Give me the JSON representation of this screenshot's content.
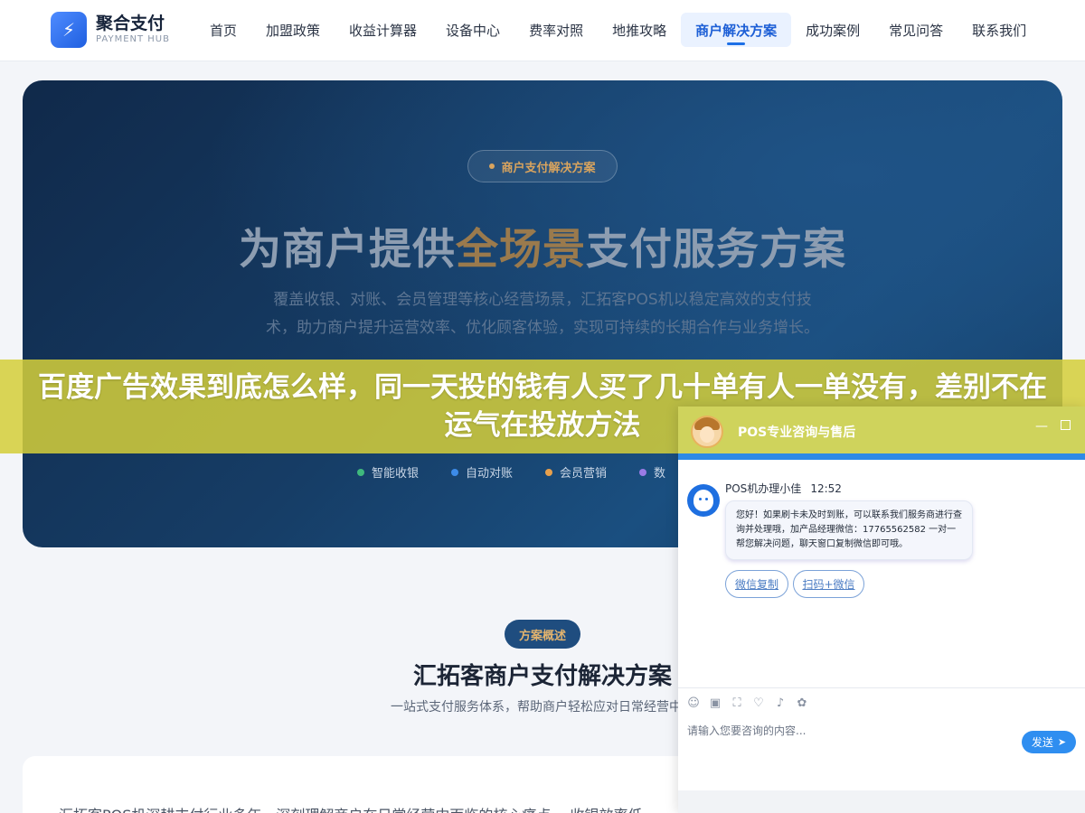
{
  "logo": {
    "name": "聚合支付",
    "sub": "PAYMENT HUB",
    "icon": "lightning-icon"
  },
  "nav": {
    "items": [
      "首页",
      "加盟政策",
      "收益计算器",
      "设备中心",
      "费率对照",
      "地推攻略",
      "商户解决方案",
      "成功案例",
      "常见问答",
      "联系我们"
    ],
    "active_index": 6
  },
  "hero": {
    "badge": "商户支付解决方案",
    "title_pre": "为商户提供",
    "title_highlight": "全场景",
    "title_post": "支付服务方案",
    "desc": "覆盖收银、对账、会员管理等核心经营场景，汇拓客POS机以稳定高效的支付技术，助力商户提升运营效率、优化顾客体验，实现可持续的长期合作与业务增长。",
    "tags": [
      {
        "label": "智能收银",
        "color": "#3fb97d"
      },
      {
        "label": "自动对账",
        "color": "#3d8be8"
      },
      {
        "label": "会员营销",
        "color": "#e8a04c"
      },
      {
        "label": "数",
        "color": "#9b7be6"
      }
    ]
  },
  "section": {
    "badge": "方案概述",
    "title": "汇拓客商户支付解决方案",
    "subtitle": "一站式支付服务体系，帮助商户轻松应对日常经营中的",
    "intro": "汇拓客POS机深耕支付行业多年，深刻理解商户在日常经营中面临的核心痛点。 收银效率低"
  },
  "banner": {
    "text": "百度广告效果到底怎么样，同一天投的钱有人买了几十单有人一单没有，差别不在运气在投放方法"
  },
  "chat": {
    "title": "POS专业咨询与售后",
    "min_label": "—",
    "agent_name": "POS机办理小佳",
    "time": "12:52",
    "message": "您好！如果刷卡未及时到账，可以联系我们服务商进行查询并处理哦，加产品经理微信：17765562582 一对一帮您解决问题，聊天窗口复制微信即可哦。",
    "quick_replies": [
      "微信复制",
      "扫码+微信"
    ],
    "placeholder": "请输入您要咨询的内容...",
    "send_label": "发送"
  }
}
